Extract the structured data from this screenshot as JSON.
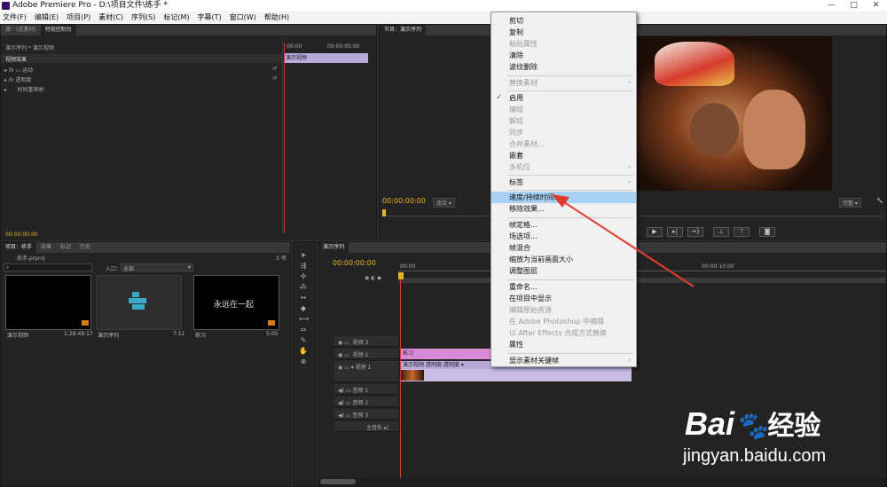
{
  "window": {
    "title": "Adobe Premiere Pro - D:\\项目文件\\练手 *",
    "minimize": "—",
    "maximize": "□",
    "close": "✕"
  },
  "menu": [
    "文件(F)",
    "编辑(E)",
    "项目(P)",
    "素材(C)",
    "序列(S)",
    "标记(M)",
    "字幕(T)",
    "窗口(W)",
    "帮助(H)"
  ],
  "effect_controls": {
    "tabs": [
      "源：(无素材)",
      "特效控制台"
    ],
    "header": "演示序列 * 演示视频",
    "timecode_start": "00:00",
    "timecode_end": "00:00:05:00",
    "section": "视频效果",
    "clip_label": "演示视频",
    "effects": [
      "运动",
      "透明度",
      "时间重映射"
    ],
    "footer_time": "00:00:00:00"
  },
  "program": {
    "tab": "节目：演示序列",
    "timecode": "00:00:00:00",
    "fit": "适合",
    "quality": "完整"
  },
  "project": {
    "tabs": [
      "项目：练手",
      "效果",
      "标记",
      "历史"
    ],
    "filename": "练手.prproj",
    "item_count": "3 项",
    "search_label": "入口：",
    "search_value": "全部",
    "items": [
      {
        "name": "演示视频",
        "duration": "1:28:49:17"
      },
      {
        "name": "演示序列",
        "duration": "7:11"
      },
      {
        "name": "练习",
        "duration": "5:05",
        "text": "永远在一起"
      }
    ]
  },
  "timeline": {
    "tab": "演示序列",
    "timecode": "00:00:00:00",
    "ruler": [
      "00:00",
      "00:00:10:00"
    ],
    "tracks": [
      {
        "name": "视频 3"
      },
      {
        "name": "视频 2"
      },
      {
        "name": "视频 1"
      },
      {
        "name": "音频 1"
      },
      {
        "name": "音频 2"
      },
      {
        "name": "音频 3"
      },
      {
        "name": "主音轨"
      }
    ],
    "clip_v2": "练习",
    "clip_v1": "演示视频  透明度:透明度 ▾"
  },
  "context_menu": {
    "items": [
      {
        "label": "剪切",
        "enabled": true
      },
      {
        "label": "复制",
        "enabled": true
      },
      {
        "label": "粘贴属性",
        "enabled": false
      },
      {
        "label": "清除",
        "enabled": true
      },
      {
        "label": "波纹删除",
        "enabled": true
      },
      {
        "label": "替换素材",
        "enabled": false,
        "submenu": true
      },
      {
        "label": "启用",
        "enabled": true,
        "checked": true
      },
      {
        "label": "编组",
        "enabled": false
      },
      {
        "label": "解组",
        "enabled": false
      },
      {
        "label": "同步",
        "enabled": false
      },
      {
        "label": "合并素材...",
        "enabled": false
      },
      {
        "label": "嵌套",
        "enabled": true
      },
      {
        "label": "多机位",
        "enabled": false,
        "submenu": true
      },
      {
        "label": "标签",
        "enabled": true,
        "submenu": true
      },
      {
        "label": "速度/持续时间...",
        "enabled": true,
        "highlighted": true
      },
      {
        "label": "移除效果...",
        "enabled": true
      },
      {
        "label": "帧定格...",
        "enabled": true
      },
      {
        "label": "场选项...",
        "enabled": true
      },
      {
        "label": "帧混合",
        "enabled": true
      },
      {
        "label": "缩放为当前画面大小",
        "enabled": true
      },
      {
        "label": "调整图层",
        "enabled": true
      },
      {
        "label": "重命名...",
        "enabled": true
      },
      {
        "label": "在项目中显示",
        "enabled": true
      },
      {
        "label": "编辑原始资源",
        "enabled": false
      },
      {
        "label": "在 Adobe Photoshop 中编辑",
        "enabled": false
      },
      {
        "label": "以 After Effects 合成方式替换",
        "enabled": false
      },
      {
        "label": "属性",
        "enabled": true
      },
      {
        "label": "显示素材关键帧",
        "enabled": true,
        "submenu": true
      }
    ]
  },
  "watermark": {
    "brand_left": "Bai",
    "brand_right": "经验",
    "url": "jingyan.baidu.com"
  },
  "colors": {
    "timecode": "#e8b31e",
    "highlight": "#a9d0f5",
    "clip_video": "#b8a9d9",
    "clip_title": "#d98ad6",
    "arrow": "#e23b2e"
  }
}
